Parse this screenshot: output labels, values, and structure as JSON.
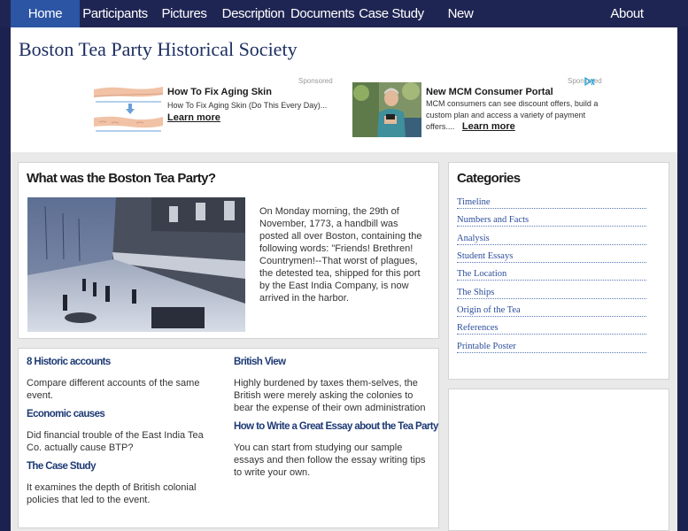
{
  "nav": {
    "items": [
      {
        "label": "Home",
        "active": true
      },
      {
        "label": "Participants"
      },
      {
        "label": "Pictures"
      },
      {
        "label": "Description"
      },
      {
        "label": "Documents"
      },
      {
        "label": "Case Study"
      },
      {
        "label": "New"
      },
      {
        "label": "About"
      }
    ]
  },
  "site": {
    "title": "Boston Tea Party Historical Society"
  },
  "ads": {
    "sponsored_label": "Sponsored",
    "items": [
      {
        "title": "How To Fix Aging Skin",
        "text": "How To Fix Aging Skin (Do This Every Day)...",
        "more": "Learn more"
      },
      {
        "title": "New MCM Consumer Portal",
        "text": "MCM consumers can see discount offers, build a custom plan and access a variety of payment offers....",
        "more": "Learn more"
      }
    ],
    "adchoices_icon": "adchoices-icon"
  },
  "main": {
    "heading": "What was the Boston Tea Party?",
    "body": "On Monday morning, the 29th of November, 1773, a handbill was posted all over Boston, containing the following words: \"Friends! Brethren! Countrymen!--That worst of plagues, the detested tea, shipped for this port by the East India Company, is now arrived in the harbor."
  },
  "articles": {
    "left": [
      {
        "title": "8 Historic accounts",
        "text": "Compare different accounts of the same event."
      },
      {
        "title": "Economic causes",
        "text": "Did financial trouble of the East India Tea Co. actually cause BTP?"
      },
      {
        "title": "The Case Study",
        "text": "It examines the depth of British colonial policies that led to the event."
      }
    ],
    "right": [
      {
        "title": "British View",
        "text": "Highly burdened by taxes them-selves, the British were merely asking the colonies to bear the expense of their own administration"
      },
      {
        "title": "How to Write a Great Essay about the Tea Party",
        "text": "You can start from studying our sample essays and then follow the essay writing tips to write your own."
      }
    ]
  },
  "categories": {
    "heading": "Categories",
    "items": [
      "Timeline",
      "Numbers and Facts",
      "Analysis",
      "Student Essays",
      "The Location",
      "The Ships",
      "Origin of the Tea",
      "References",
      "Printable Poster"
    ]
  },
  "colors": {
    "nav_bg": "#1f2553",
    "nav_active": "#2c55a4",
    "link": "#2b4d9b",
    "title": "#1c2f60"
  }
}
